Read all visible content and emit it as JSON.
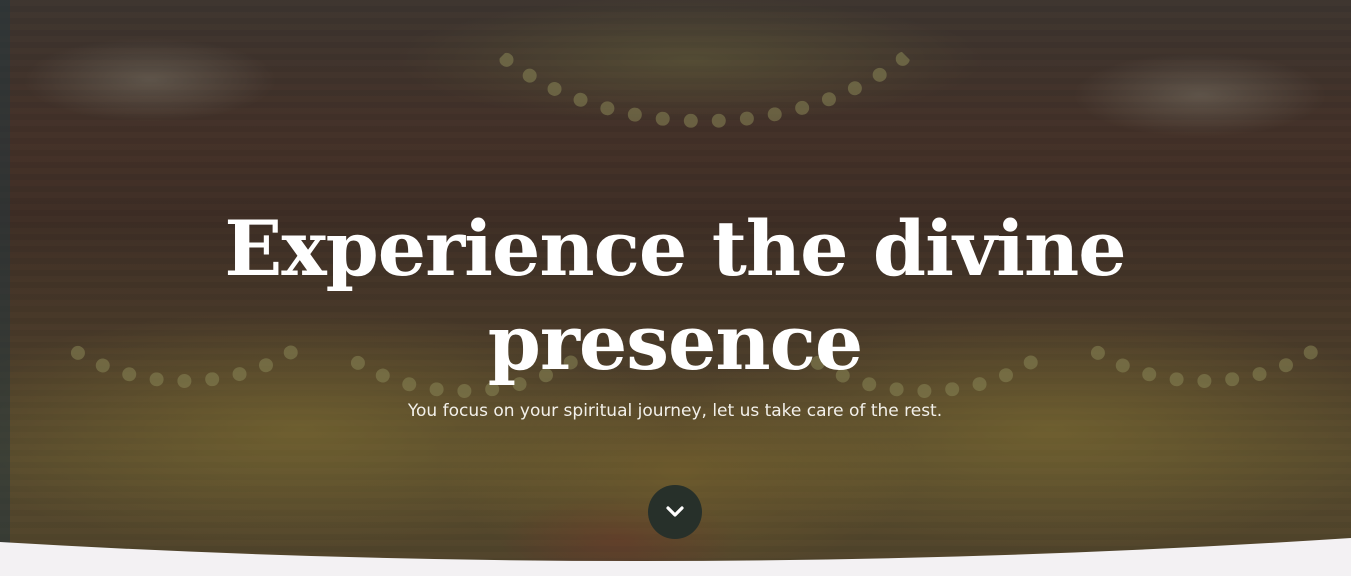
{
  "hero": {
    "headline": "Experience the divine presence",
    "subtitle": "You focus on your spiritual journey, let us take care of the rest.",
    "scroll_icon": "chevron-down-icon"
  },
  "colors": {
    "headline": "#ffffff",
    "scroll_button": "#27302a",
    "page_background": "#f3f1f3"
  }
}
